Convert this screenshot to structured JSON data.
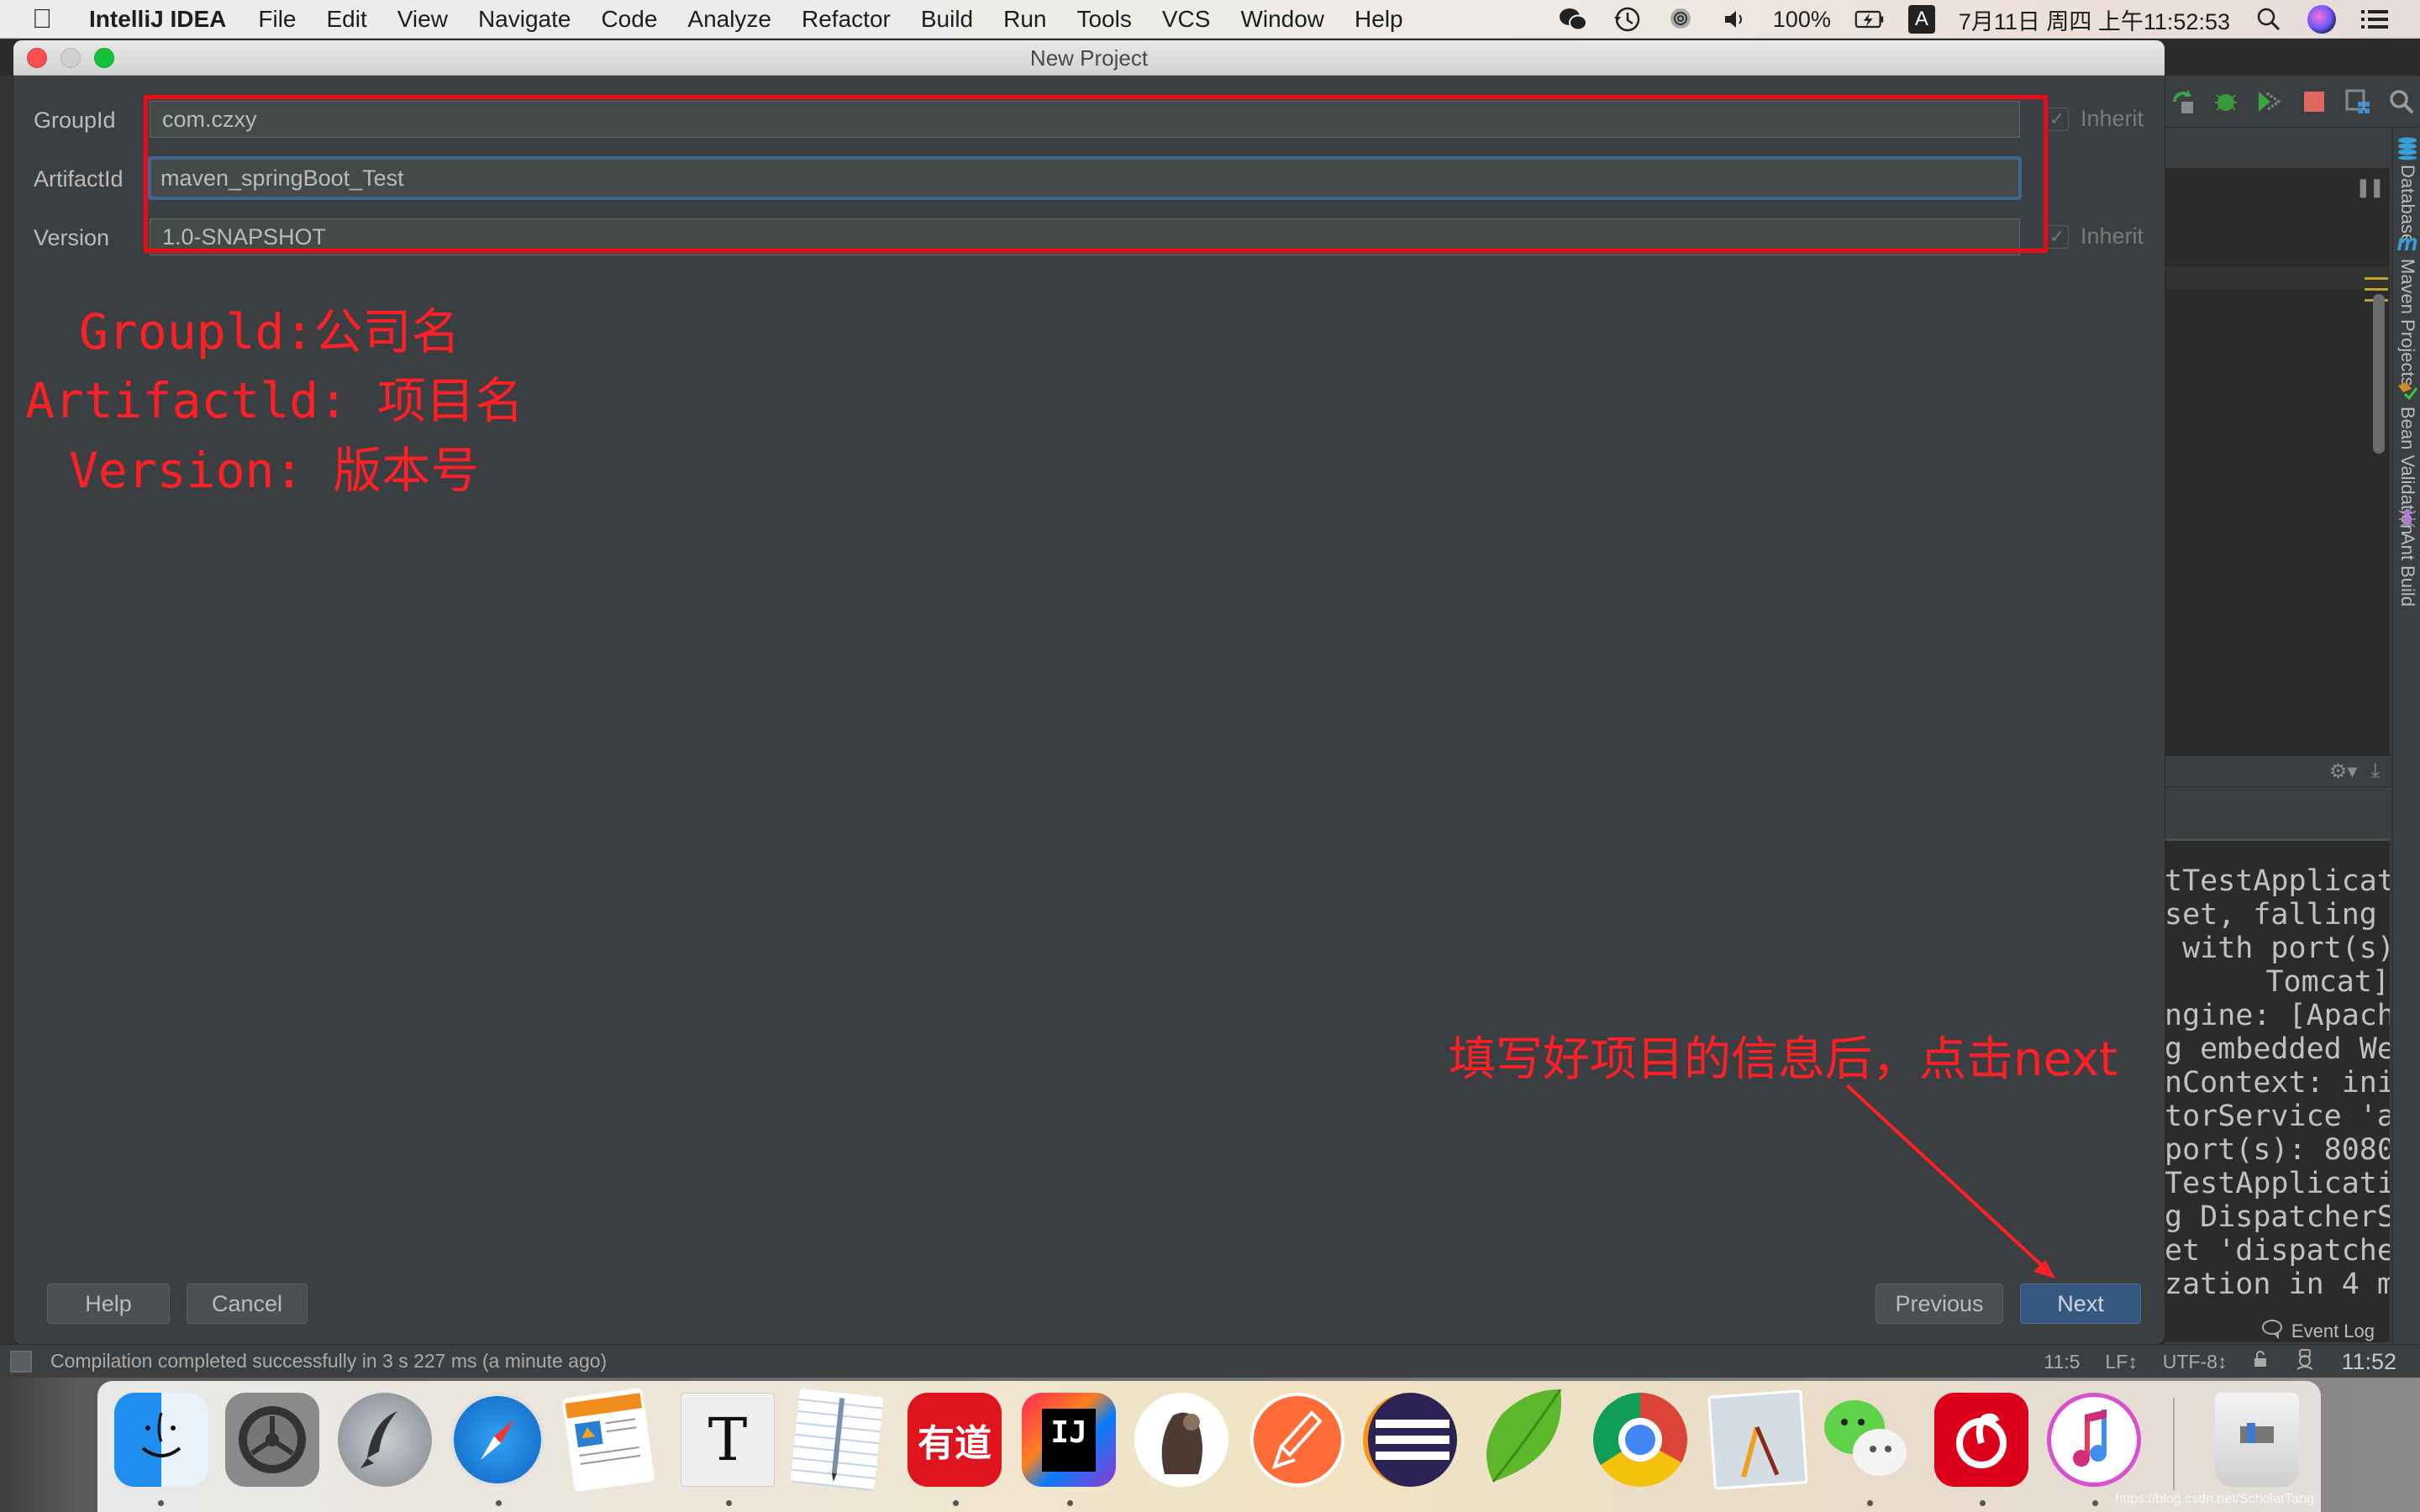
{
  "menubar": {
    "app_name": "IntelliJ IDEA",
    "items": [
      "File",
      "Edit",
      "View",
      "Navigate",
      "Code",
      "Analyze",
      "Refactor",
      "Build",
      "Run",
      "Tools",
      "VCS",
      "Window",
      "Help"
    ],
    "status": {
      "battery": "100%",
      "input_method": "A",
      "datetime": "7月11日 周四 上午11:52:53",
      "icons": [
        "wechat-icon",
        "time-machine-icon",
        "vpn-icon",
        "volume-icon",
        "battery-icon",
        "input-method-icon",
        "spotlight-icon",
        "siri-icon",
        "notification-center-icon"
      ]
    }
  },
  "dialog": {
    "title": "New Project",
    "fields": [
      {
        "label": "GroupId",
        "value": "com.czxy",
        "inherit": true,
        "inherit_label": "Inherit"
      },
      {
        "label": "ArtifactId",
        "value": "maven_springBoot_Test",
        "focused": true
      },
      {
        "label": "Version",
        "value": "1.0-SNAPSHOT",
        "inherit": true,
        "inherit_label": "Inherit"
      }
    ],
    "buttons": {
      "help": "Help",
      "cancel": "Cancel",
      "previous": "Previous",
      "next": "Next"
    }
  },
  "annotations": {
    "left_lines": [
      "Groupld:公司名",
      "Artifactld: 项目名",
      "Version: 版本号"
    ],
    "right_text": "填写好项目的信息后，点击next",
    "color": "#ff1f26"
  },
  "ide_background": {
    "tool_windows": [
      "Database",
      "Maven Projects",
      "Bean Validation",
      "Ant Build"
    ],
    "console_lines": [
      "tTestApplicat",
      "set, falling ",
      " with port(s)",
      "Tomcat]",
      "ngine: [Apach",
      "g embedded We",
      "nContext: ini",
      "torService 'a",
      "port(s): 8080",
      "TestApplicati",
      "g DispatcherS",
      "et 'dispatche",
      "zation in 4 m"
    ],
    "event_log": "Event Log"
  },
  "statusbar": {
    "message": "Compilation completed successfully in 3 s 227 ms (a minute ago)",
    "position": "11:5",
    "line_separator": "LF↕",
    "encoding": "UTF-8↕",
    "time": "11:52"
  },
  "dock": {
    "apps": [
      {
        "name": "Finder",
        "running": true
      },
      {
        "name": "System Preferences",
        "running": false
      },
      {
        "name": "Launchpad",
        "running": false
      },
      {
        "name": "Safari",
        "running": true
      },
      {
        "name": "Pages",
        "running": false
      },
      {
        "name": "Typora",
        "running": true
      },
      {
        "name": "TextEdit",
        "running": false
      },
      {
        "name": "Youdao Dictionary",
        "running": true
      },
      {
        "name": "IntelliJ IDEA",
        "running": true
      },
      {
        "name": "DBeaver",
        "running": false
      },
      {
        "name": "Postman",
        "running": false
      },
      {
        "name": "Eclipse",
        "running": false
      },
      {
        "name": "Coda",
        "running": false
      },
      {
        "name": "Google Chrome",
        "running": false
      },
      {
        "name": "Preview / Instruments",
        "running": false
      },
      {
        "name": "WeChat",
        "running": true
      },
      {
        "name": "NetEase Music",
        "running": true
      },
      {
        "name": "iTunes",
        "running": true
      },
      {
        "name": "Trash",
        "running": false
      }
    ],
    "youdao_label": "有道",
    "ij_label": "IJ",
    "watermark": "https://blog.csdn.net/ScholarTang"
  }
}
